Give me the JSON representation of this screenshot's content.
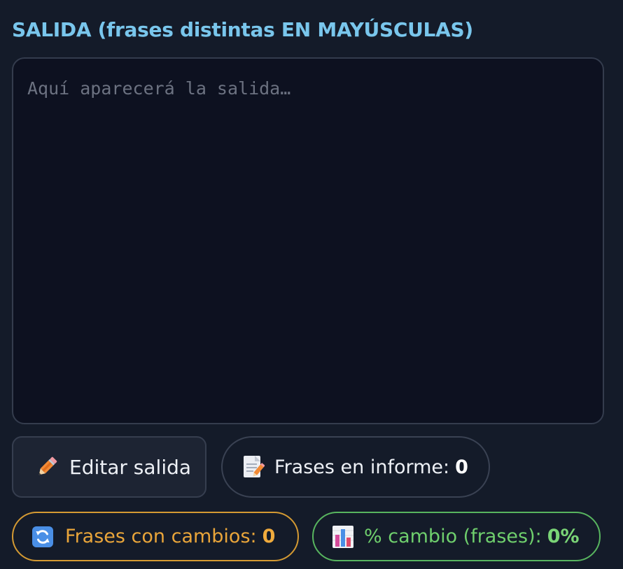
{
  "output": {
    "title": "SALIDA (frases distintas EN MAYÚSCULAS)",
    "placeholder": "Aquí aparecerá la salida…",
    "value": ""
  },
  "actions": {
    "edit_label": "Editar salida",
    "edit_icon": "pencil-icon"
  },
  "stats": {
    "report": {
      "icon": "memo-icon",
      "label": "Frases en informe:",
      "value": "0"
    },
    "changes": {
      "icon": "refresh-icon",
      "label": "Frases con cambios:",
      "value": "0",
      "color": "#e9a53a"
    },
    "percent": {
      "icon": "bar-chart-icon",
      "label": "% cambio (frases):",
      "value": "0%",
      "color": "#6fcf6d"
    }
  }
}
